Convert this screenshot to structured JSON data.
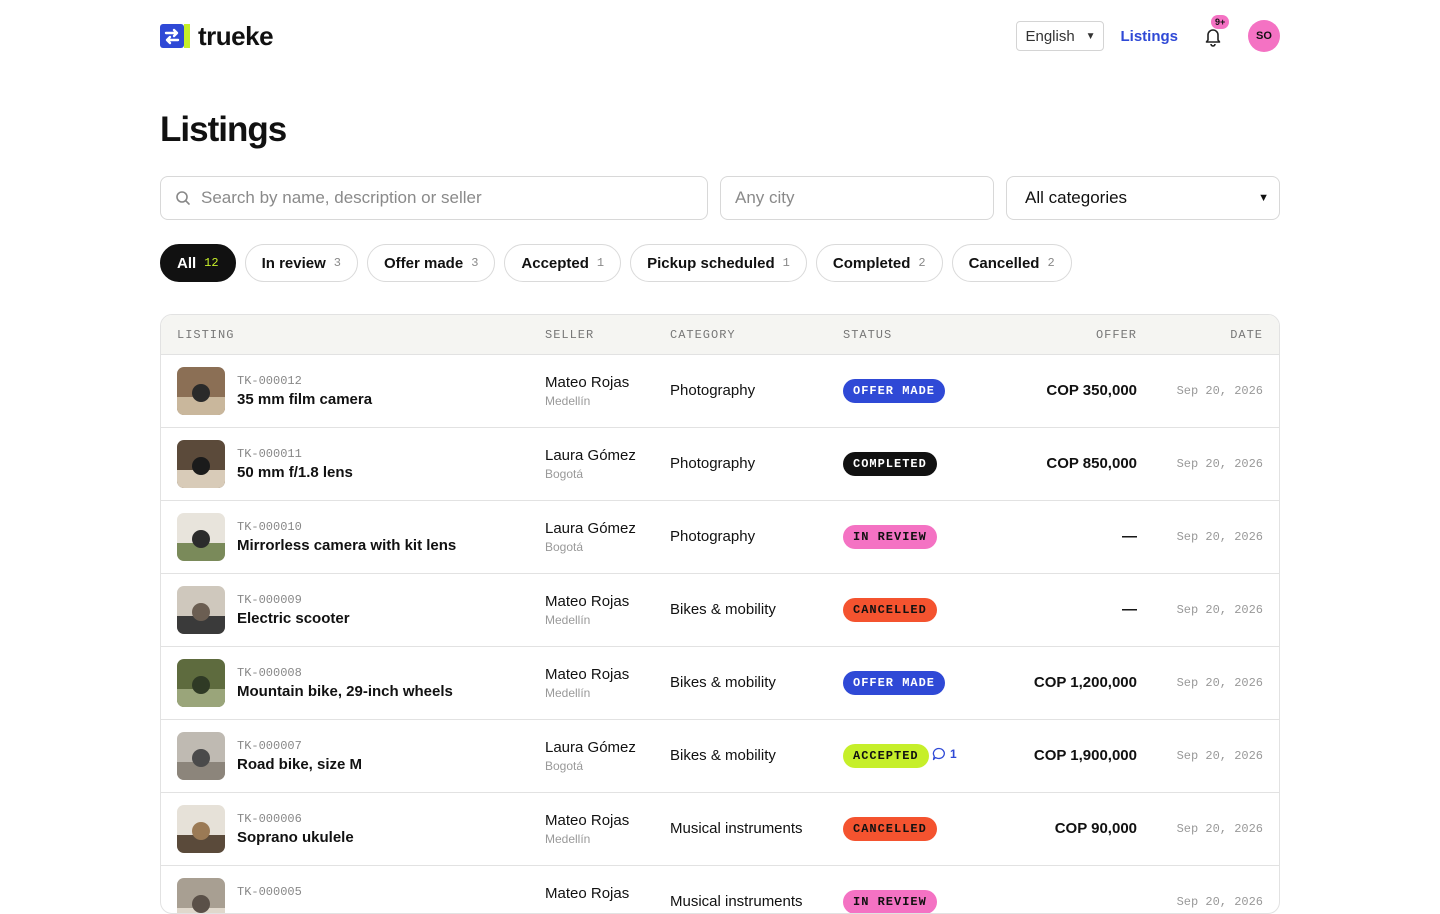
{
  "brand": {
    "name": "trueke",
    "logo_colors": {
      "blue": "#2f49d6",
      "lime": "#c6ef2a"
    }
  },
  "nav": {
    "language": "English",
    "listings_link": "Listings",
    "notifications_badge": "9+",
    "avatar_initials": "SO"
  },
  "page": {
    "title": "Listings"
  },
  "filters": {
    "search_placeholder": "Search by name, description or seller",
    "city_placeholder": "Any city",
    "category_value": "All categories"
  },
  "tabs": [
    {
      "label": "All",
      "count": "12",
      "active": true
    },
    {
      "label": "In review",
      "count": "3"
    },
    {
      "label": "Offer made",
      "count": "3"
    },
    {
      "label": "Accepted",
      "count": "1"
    },
    {
      "label": "Pickup scheduled",
      "count": "1"
    },
    {
      "label": "Completed",
      "count": "2"
    },
    {
      "label": "Cancelled",
      "count": "2"
    }
  ],
  "table": {
    "headers": {
      "listing": "LISTING",
      "seller": "SELLER",
      "category": "CATEGORY",
      "status": "STATUS",
      "offer": "OFFER",
      "date": "DATE"
    },
    "status_colors": {
      "OFFER MADE": {
        "bg": "#2f49d6",
        "fg": "#ffffff"
      },
      "COMPLETED": {
        "bg": "#111111",
        "fg": "#ffffff"
      },
      "IN REVIEW": {
        "bg": "#f472c3",
        "fg": "#111111"
      },
      "CANCELLED": {
        "bg": "#f4532f",
        "fg": "#111111"
      },
      "ACCEPTED": {
        "bg": "#c6ef2a",
        "fg": "#111111"
      }
    },
    "rows": [
      {
        "sku": "TK-000012",
        "name": "35 mm film camera",
        "seller": "Mateo Rojas",
        "city": "Medellín",
        "category": "Photography",
        "status": "OFFER MADE",
        "offer": "COP 350,000",
        "date": "Sep 20, 2026",
        "messages": ""
      },
      {
        "sku": "TK-000011",
        "name": "50 mm f/1.8 lens",
        "seller": "Laura Gómez",
        "city": "Bogotá",
        "category": "Photography",
        "status": "COMPLETED",
        "offer": "COP 850,000",
        "date": "Sep 20, 2026",
        "messages": ""
      },
      {
        "sku": "TK-000010",
        "name": "Mirrorless camera with kit lens",
        "seller": "Laura Gómez",
        "city": "Bogotá",
        "category": "Photography",
        "status": "IN REVIEW",
        "offer": "—",
        "date": "Sep 20, 2026",
        "messages": ""
      },
      {
        "sku": "TK-000009",
        "name": "Electric scooter",
        "seller": "Mateo Rojas",
        "city": "Medellín",
        "category": "Bikes & mobility",
        "status": "CANCELLED",
        "offer": "—",
        "date": "Sep 20, 2026",
        "messages": ""
      },
      {
        "sku": "TK-000008",
        "name": "Mountain bike, 29-inch wheels",
        "seller": "Mateo Rojas",
        "city": "Medellín",
        "category": "Bikes & mobility",
        "status": "OFFER MADE",
        "offer": "COP 1,200,000",
        "date": "Sep 20, 2026",
        "messages": ""
      },
      {
        "sku": "TK-000007",
        "name": "Road bike, size M",
        "seller": "Laura Gómez",
        "city": "Bogotá",
        "category": "Bikes & mobility",
        "status": "ACCEPTED",
        "offer": "COP 1,900,000",
        "date": "Sep 20, 2026",
        "messages": "1"
      },
      {
        "sku": "TK-000006",
        "name": "Soprano ukulele",
        "seller": "Mateo Rojas",
        "city": "Medellín",
        "category": "Musical instruments",
        "status": "CANCELLED",
        "offer": "COP 90,000",
        "date": "Sep 20, 2026",
        "messages": ""
      },
      {
        "sku": "TK-000005",
        "name": "",
        "seller": "Mateo Rojas",
        "city": "",
        "category": "Musical instruments",
        "status": "IN REVIEW",
        "offer": "",
        "date": "Sep 20, 2026",
        "messages": ""
      }
    ]
  }
}
